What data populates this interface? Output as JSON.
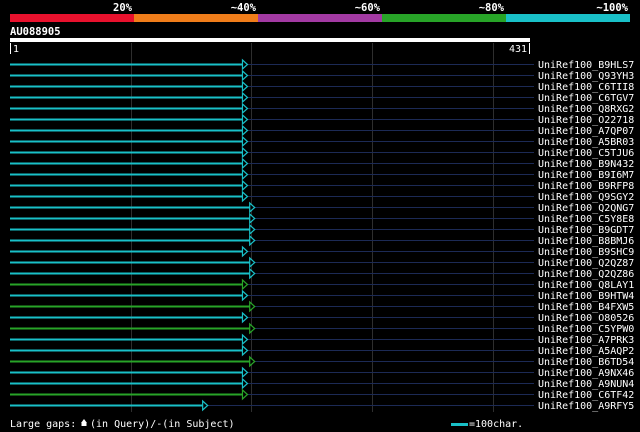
{
  "identity_legend": [
    {
      "label": "20%",
      "color": "#e8112d"
    },
    {
      "label": "~40%",
      "color": "#f07d1a"
    },
    {
      "label": "~60%",
      "color": "#a33aa3"
    },
    {
      "label": "~80%",
      "color": "#28a428"
    },
    {
      "label": "~100%",
      "color": "#19c0c8"
    }
  ],
  "query": {
    "id": "AU088905",
    "start": "1",
    "end": "431",
    "length": 431
  },
  "hits": [
    {
      "name": "UniRef100_B9HLS7",
      "end": 196,
      "color": "#19c0c8"
    },
    {
      "name": "UniRef100_Q93YH3",
      "end": 196,
      "color": "#19c0c8"
    },
    {
      "name": "UniRef100_C6TII8",
      "end": 196,
      "color": "#19c0c8"
    },
    {
      "name": "UniRef100_C6TGV7",
      "end": 196,
      "color": "#19c0c8"
    },
    {
      "name": "UniRef100_Q8RXG2",
      "end": 196,
      "color": "#19c0c8"
    },
    {
      "name": "UniRef100_O22718",
      "end": 196,
      "color": "#19c0c8"
    },
    {
      "name": "UniRef100_A7QP07",
      "end": 196,
      "color": "#19c0c8"
    },
    {
      "name": "UniRef100_A5BR03",
      "end": 196,
      "color": "#19c0c8"
    },
    {
      "name": "UniRef100_C5TJU6",
      "end": 196,
      "color": "#19c0c8"
    },
    {
      "name": "UniRef100_B9N432",
      "end": 196,
      "color": "#19c0c8"
    },
    {
      "name": "UniRef100_B9I6M7",
      "end": 196,
      "color": "#19c0c8"
    },
    {
      "name": "UniRef100_B9RFP8",
      "end": 196,
      "color": "#19c0c8"
    },
    {
      "name": "UniRef100_Q9SGY2",
      "end": 196,
      "color": "#19c0c8"
    },
    {
      "name": "UniRef100_Q2QNG7",
      "end": 202,
      "color": "#19c0c8"
    },
    {
      "name": "UniRef100_C5Y8E8",
      "end": 202,
      "color": "#19c0c8"
    },
    {
      "name": "UniRef100_B9GDT7",
      "end": 202,
      "color": "#19c0c8"
    },
    {
      "name": "UniRef100_B8BMJ6",
      "end": 202,
      "color": "#19c0c8"
    },
    {
      "name": "UniRef100_B9SHC9",
      "end": 196,
      "color": "#19c0c8"
    },
    {
      "name": "UniRef100_Q2QZ87",
      "end": 202,
      "color": "#19c0c8"
    },
    {
      "name": "UniRef100_Q2QZ86",
      "end": 202,
      "color": "#19c0c8"
    },
    {
      "name": "UniRef100_Q8LAY1",
      "end": 196,
      "color": "#28a428"
    },
    {
      "name": "UniRef100_B9HTW4",
      "end": 196,
      "color": "#19c0c8"
    },
    {
      "name": "UniRef100_B4FXW5",
      "end": 202,
      "color": "#28a428"
    },
    {
      "name": "UniRef100_O80526",
      "end": 196,
      "color": "#19c0c8"
    },
    {
      "name": "UniRef100_C5YPW0",
      "end": 202,
      "color": "#28a428"
    },
    {
      "name": "UniRef100_A7PRK3",
      "end": 196,
      "color": "#19c0c8"
    },
    {
      "name": "UniRef100_A5AQP2",
      "end": 196,
      "color": "#19c0c8"
    },
    {
      "name": "UniRef100_B6TD54",
      "end": 202,
      "color": "#28a428"
    },
    {
      "name": "UniRef100_A9NX46",
      "end": 196,
      "color": "#19c0c8"
    },
    {
      "name": "UniRef100_A9NUN4",
      "end": 196,
      "color": "#19c0c8"
    },
    {
      "name": "UniRef100_C6TF42",
      "end": 196,
      "color": "#28a428"
    },
    {
      "name": "UniRef100_A9RFY5",
      "end": 163,
      "color": "#19c0c8"
    }
  ],
  "footer": {
    "gaps_label": "Large gaps:",
    "gaps_query": "(in Query)/",
    "gaps_dash": "-",
    "gaps_subject": "(in Subject)",
    "scale_label": "=100char.",
    "scale_color": "#19c0c8"
  }
}
